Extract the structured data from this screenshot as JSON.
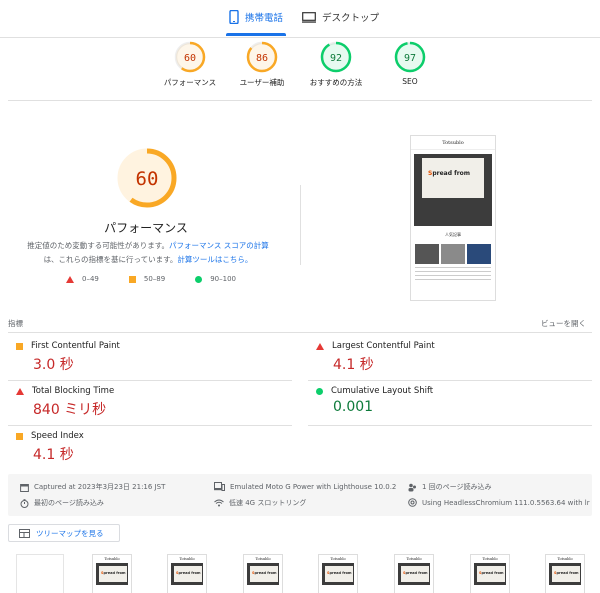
{
  "tabs": {
    "mobile": "携帯電話",
    "desktop": "デスクトップ"
  },
  "gauges": [
    {
      "score": "60",
      "label": "パフォーマンス",
      "value": 60,
      "color": "#f9a825",
      "text_color": "#c33300"
    },
    {
      "score": "86",
      "label": "ユーザー補助",
      "value": 86,
      "color": "#f9a825",
      "text_color": "#c33300"
    },
    {
      "score": "92",
      "label": "おすすめの方法",
      "value": 92,
      "color": "#0cce6b",
      "text_color": "#0d7a3a"
    },
    {
      "score": "97",
      "label": "SEO",
      "value": 97,
      "color": "#0cce6b",
      "text_color": "#0d7a3a"
    }
  ],
  "performance": {
    "score": "60",
    "value": 60,
    "title": "パフォーマンス",
    "desc_1": "推定値のため変動する可能性があります。",
    "desc_link_1": "パフォーマンス スコアの計算",
    "desc_2": "は、これらの指標を基に行っています。",
    "desc_link_2": "計算ツールはこちら。"
  },
  "legend": {
    "fail": "0–49",
    "average": "50–89",
    "pass": "90–100"
  },
  "screenshot": {
    "site_title": "Totsublo",
    "hero_accent": "S",
    "hero_text": "pread from",
    "section": "人気記事"
  },
  "metrics_header": {
    "left": "指標",
    "right": "ビューを開く"
  },
  "metrics": [
    {
      "name": "First Contentful Paint",
      "value": "3.0 秒"
    },
    {
      "name": "Largest Contentful Paint",
      "value": "4.1 秒"
    },
    {
      "name": "Total Blocking Time",
      "value": "840 ミリ秒"
    },
    {
      "name": "Cumulative Layout Shift",
      "value": "0.001"
    },
    {
      "name": "Speed Index",
      "value": "4.1 秒"
    }
  ],
  "environment": {
    "captured": "Captured at 2023年3月23日 21:16 JST",
    "device": "Emulated Moto G Power with Lighthouse 10.0.2",
    "loads": "1 回のページ読み込み",
    "initial": "最初のページ読み込み",
    "throttle": "低速 4G スロットリング",
    "browser": "Using HeadlessChromium 111.0.5563.64 with lr"
  },
  "treemap_label": "ツリーマップを見る",
  "filmstrip": {
    "frame_title": "Totsublo",
    "frame_accent": "S",
    "frame_text": "pread from"
  },
  "colors": {
    "accent": "#1a73e8",
    "fail": "#e53935",
    "average": "#f9a825",
    "pass": "#0cce6b"
  }
}
